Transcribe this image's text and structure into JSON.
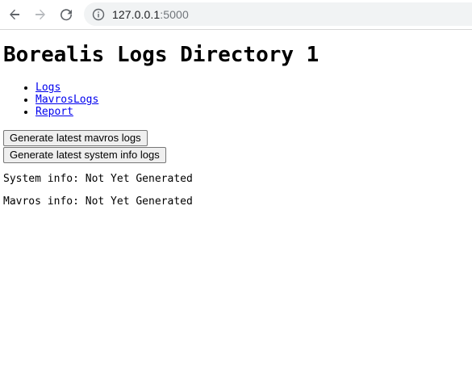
{
  "browser": {
    "url_host": "127.0.0.1",
    "url_port": ":5000"
  },
  "page": {
    "title": "Borealis Logs Directory 1",
    "links": [
      "Logs",
      "MavrosLogs",
      "Report"
    ],
    "buttons": {
      "mavros": "Generate latest mavros logs",
      "system": "Generate latest system info logs"
    },
    "system_info_text": "System info: Not Yet Generated",
    "mavros_info_text": "Mavros info: Not Yet Generated"
  }
}
